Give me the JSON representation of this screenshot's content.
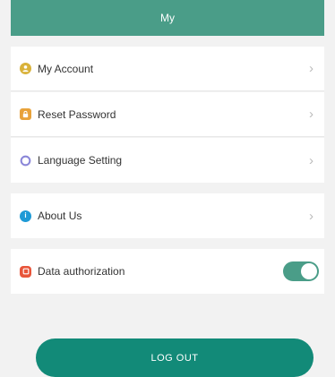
{
  "header": {
    "title": "My"
  },
  "menu": [
    {
      "label": "My Account",
      "icon": "user-icon",
      "color": "#d9b23a"
    },
    {
      "label": "Reset Password",
      "icon": "lock-icon",
      "color": "#e8a23a"
    },
    {
      "label": "Language Setting",
      "icon": "globe-icon",
      "color": "#8a86d8"
    },
    {
      "label": "About Us",
      "icon": "info-icon",
      "color": "#1e9ad6"
    }
  ],
  "data_authorization": {
    "label": "Data authorization",
    "icon": "shield-icon",
    "color": "#e8553a",
    "enabled": true
  },
  "logout": {
    "label": "LOG OUT"
  },
  "colors": {
    "accent": "#4a9d88",
    "button": "#128a78",
    "background": "#f2f2f2"
  }
}
